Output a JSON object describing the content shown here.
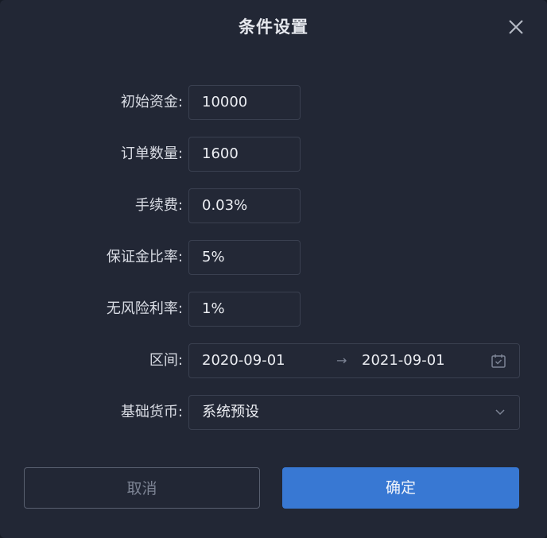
{
  "dialog": {
    "title": "条件设置"
  },
  "fields": {
    "initial_capital": {
      "label": "初始资金:",
      "value": "10000"
    },
    "order_qty": {
      "label": "订单数量:",
      "value": "1600"
    },
    "fee": {
      "label": "手续费:",
      "value": "0.03%"
    },
    "margin_ratio": {
      "label": "保证金比率:",
      "value": "5%"
    },
    "risk_free_rate": {
      "label": "无风险利率:",
      "value": "1%"
    },
    "interval": {
      "label": "区间:",
      "start": "2020-09-01",
      "arrow": "→",
      "end": "2021-09-01"
    },
    "base_currency": {
      "label": "基础货币:",
      "selected": "系统预设"
    }
  },
  "buttons": {
    "cancel": "取消",
    "ok": "确定"
  },
  "icons": {
    "close": "close-icon",
    "calendar": "calendar-icon",
    "dropdown": "chevron-down-icon"
  },
  "colors": {
    "background": "#222735",
    "accent": "#3878d3",
    "border": "#3a4050",
    "text": "#eceef3"
  }
}
